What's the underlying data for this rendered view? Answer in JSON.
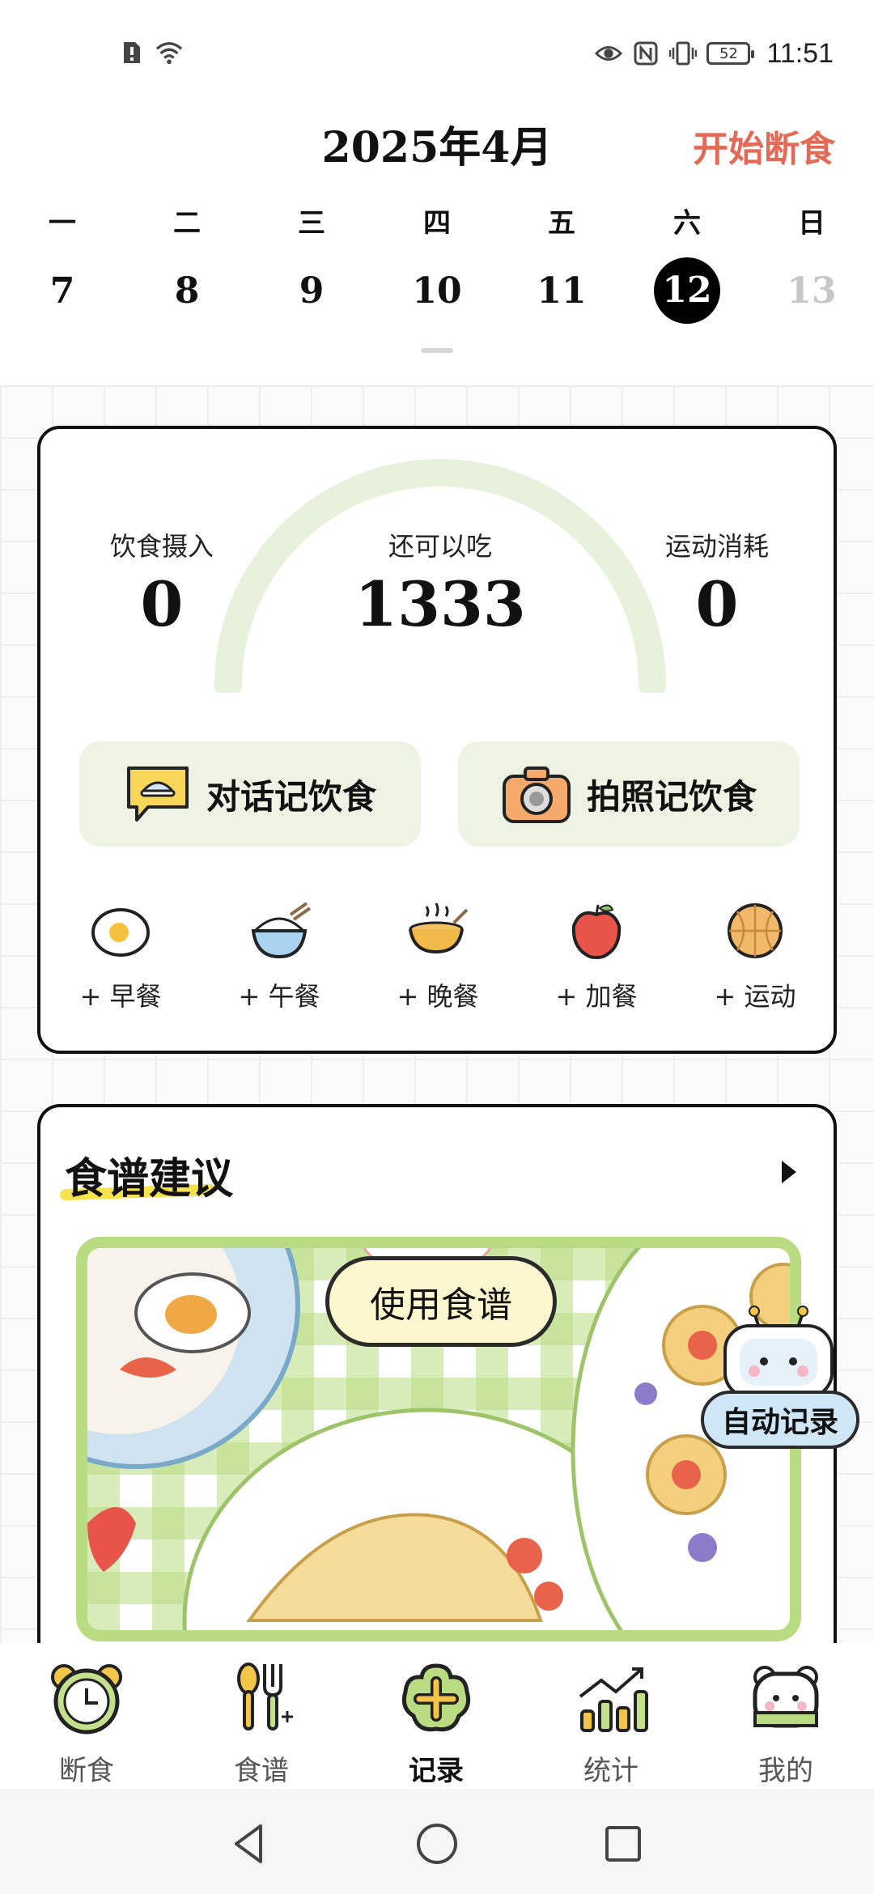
{
  "status_bar": {
    "battery": "52",
    "time": "11:51",
    "icons": [
      "sim-alert-icon",
      "wifi-icon",
      "eye-icon",
      "nfc-icon",
      "vibrate-icon",
      "battery-icon"
    ]
  },
  "header": {
    "month": "2025年4月",
    "start_fast": "开始断食"
  },
  "calendar": {
    "weekdays": [
      "一",
      "二",
      "三",
      "四",
      "五",
      "六",
      "日"
    ],
    "days": [
      "7",
      "8",
      "9",
      "10",
      "11",
      "12",
      "13"
    ],
    "selected_index": 5
  },
  "summary": {
    "intake_label": "饮食摄入",
    "intake_value": "0",
    "remaining_label": "还可以吃",
    "remaining_value": "1333",
    "burn_label": "运动消耗",
    "burn_value": "0",
    "remaining_fraction": 0
  },
  "actions": {
    "chat_label": "对话记饮食",
    "photo_label": "拍照记饮食"
  },
  "meals": [
    {
      "label": "+ 早餐",
      "icon": "egg-icon"
    },
    {
      "label": "+ 午餐",
      "icon": "rice-bowl-icon"
    },
    {
      "label": "+ 晚餐",
      "icon": "soup-bowl-icon"
    },
    {
      "label": "+ 加餐",
      "icon": "apple-icon"
    },
    {
      "label": "+ 运动",
      "icon": "basketball-icon"
    }
  ],
  "recipe": {
    "title": "食谱建议",
    "use_label": "使用食谱",
    "auto_record_label": "自动记录"
  },
  "nav": [
    {
      "label": "断食",
      "icon": "alarm-clock-icon"
    },
    {
      "label": "食谱",
      "icon": "utensils-icon"
    },
    {
      "label": "记录",
      "icon": "add-record-icon"
    },
    {
      "label": "统计",
      "icon": "stats-chart-icon"
    },
    {
      "label": "我的",
      "icon": "bear-profile-icon"
    }
  ],
  "nav_active_index": 2,
  "colors": {
    "accent_red": "#e26a57",
    "light_green": "#eef3e3",
    "gauge_track": "#e8f1dc",
    "recipe_border": "#b9dc82"
  }
}
